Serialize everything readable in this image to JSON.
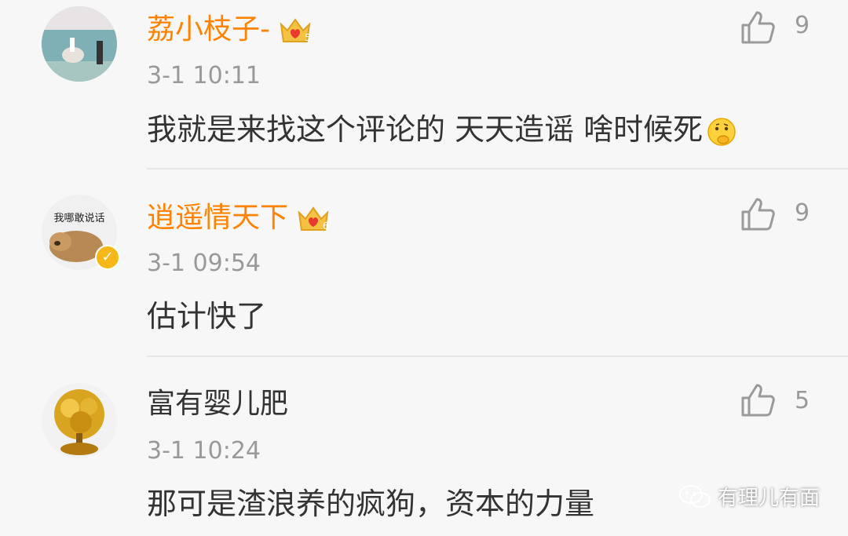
{
  "colors": {
    "vip_name": "#ff8200",
    "text": "#333333",
    "meta": "#999999",
    "background": "#f7f7f7"
  },
  "comments": [
    {
      "username": "荔小枝子-",
      "vip": true,
      "crown_icon": "vip-crown-icon",
      "time": "3-1 10:11",
      "likes": "9",
      "text": "我就是来找这个评论的 天天造谣 啥时候死",
      "emoji": "thinking-emoji"
    },
    {
      "username": "逍遥情天下",
      "vip": true,
      "crown_icon": "vip-crown-icon",
      "time": "3-1 09:54",
      "likes": "9",
      "text": "估计快了",
      "avatar_caption": "我哪敢说话",
      "verified_icon": "verified-badge-icon"
    },
    {
      "username": "富有婴儿肥",
      "vip": false,
      "time": "3-1 10:24",
      "likes": "5",
      "text": "那可是渣浪养的疯狗，资本的力量"
    }
  ],
  "watermark": {
    "text": "有理儿有面",
    "icon": "wechat-icon"
  }
}
